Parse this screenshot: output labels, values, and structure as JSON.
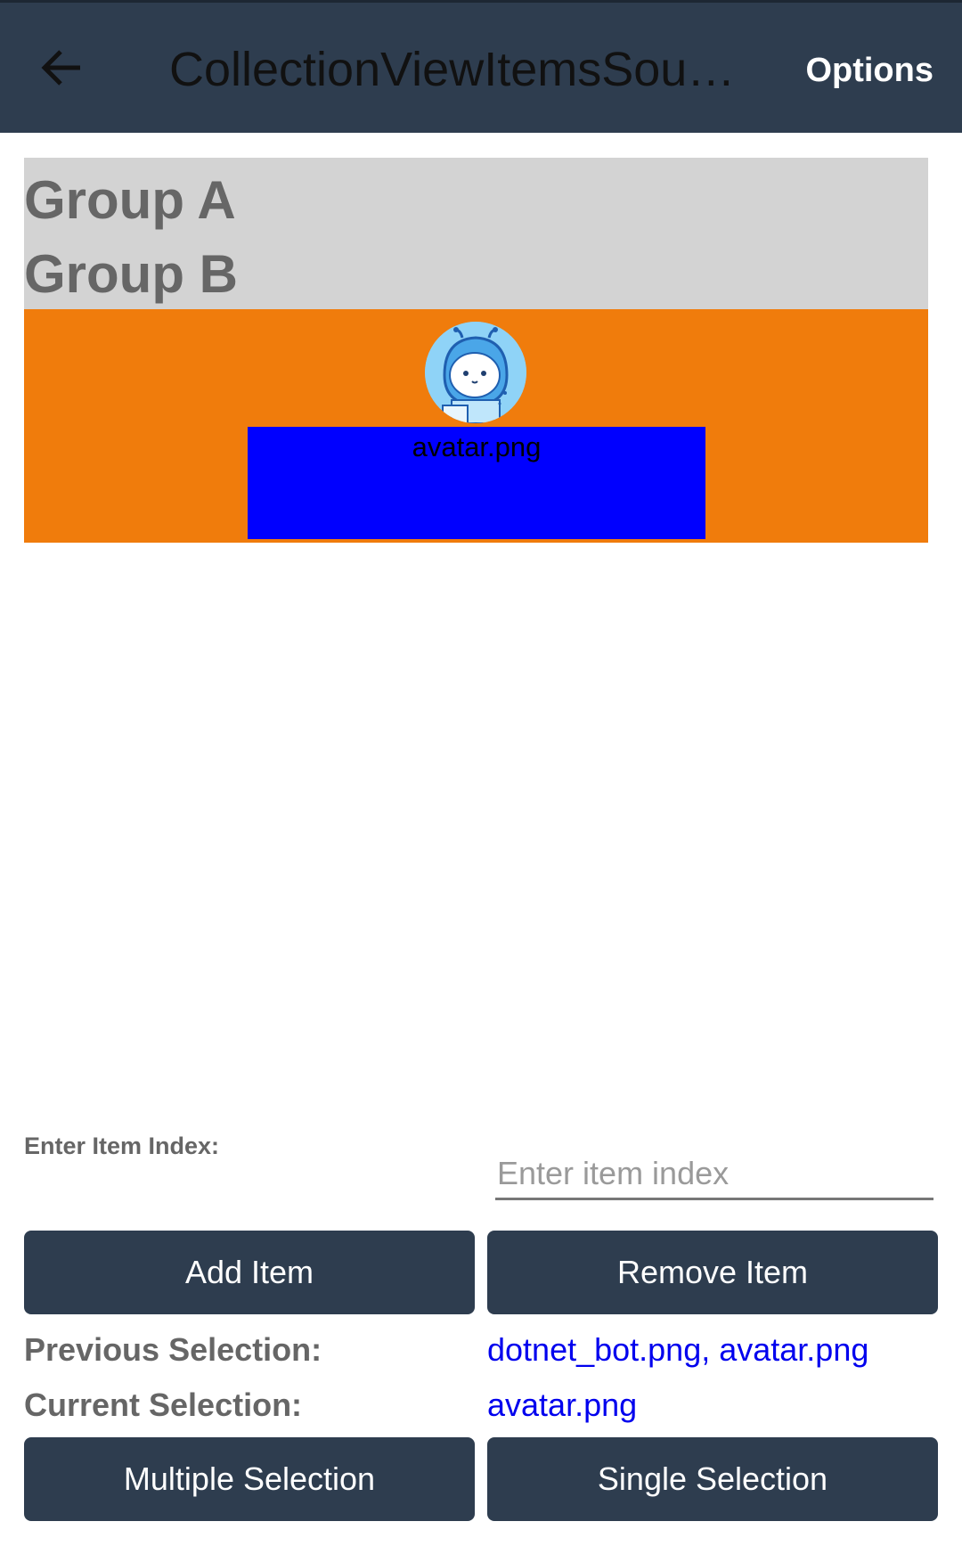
{
  "toolbar": {
    "title": "CollectionViewItemsSourceGroupedPage",
    "options_label": "Options",
    "back_icon": "arrow-left-icon"
  },
  "collection": {
    "group_headers": [
      "Group A",
      "Group B"
    ],
    "item": {
      "image_icon": "dotnet-bot-avatar-icon",
      "caption": "avatar.png"
    }
  },
  "index_entry": {
    "label": "Enter Item Index:",
    "placeholder": "Enter item index",
    "value": ""
  },
  "buttons": {
    "add": "Add Item",
    "remove": "Remove Item",
    "multiple": "Multiple Selection",
    "single": "Single Selection"
  },
  "selection": {
    "previous_label": "Previous Selection:",
    "previous_value": "dotnet_bot.png, avatar.png",
    "current_label": "Current Selection:",
    "current_value": "avatar.png"
  },
  "colors": {
    "toolbar": "#2e3d4f",
    "header_bg": "#d3d3d3",
    "item_bg": "#f07c0c",
    "caption_bg": "#0000ff",
    "link_text": "#0000ee"
  }
}
